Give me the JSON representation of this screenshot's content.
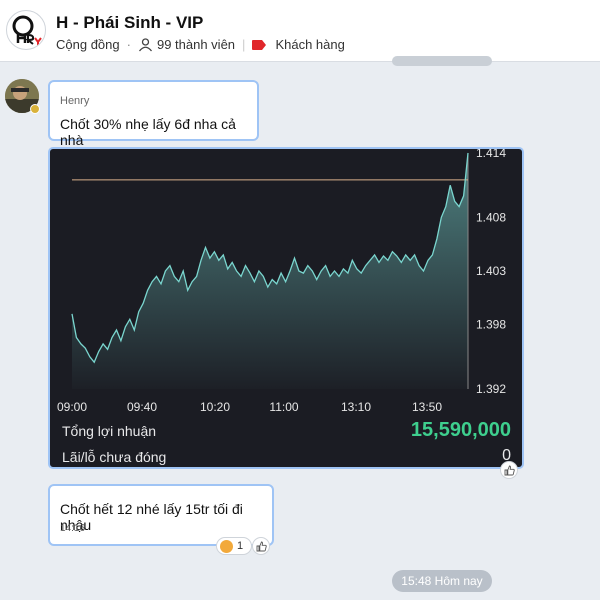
{
  "group": {
    "title": "H - Phái Sinh - VIP",
    "type_label": "Cộng đồng",
    "members_label": "99 thành viên",
    "tag_label": "Khách hàng",
    "tag_color": "#e0262a"
  },
  "messages": [
    {
      "sender": "Henry",
      "text": "Chốt 30% nhẹ lấy 6đ nha cả nhà"
    },
    {
      "text": "Chốt hết 12 nhé lấy 15tr tối đi nhậu",
      "time": "14:16",
      "reaction_count": "1"
    }
  ],
  "pnl": {
    "total_label": "Tổng lợi nhuận",
    "total_value": "15,590,000",
    "unrealized_label": "Lãi/lỗ chưa đóng",
    "unrealized_value": "0"
  },
  "date_divider": "15:48 Hôm nay",
  "colors": {
    "accent": "#9fc4f5",
    "profit": "#3ecf8e",
    "line": "#7ad6cf",
    "target_line": "#d9b08c"
  },
  "chart_data": {
    "type": "area",
    "x_ticks": [
      "09:00",
      "09:40",
      "10:20",
      "11:00",
      "13:10",
      "13:50"
    ],
    "y_ticks": [
      "1.414",
      "1.408",
      "1.403",
      "1.398",
      "1.392"
    ],
    "ylim": [
      1.392,
      1.414
    ],
    "reference_line": 1.4115,
    "series": [
      {
        "values": [
          1.399,
          1.3968,
          1.3962,
          1.3958,
          1.395,
          1.3945,
          1.3955,
          1.3962,
          1.3957,
          1.3968,
          1.3975,
          1.3965,
          1.3978,
          1.3985,
          1.3975,
          1.3992,
          1.4,
          1.4012,
          1.402,
          1.4025,
          1.4018,
          1.403,
          1.4035,
          1.4025,
          1.402,
          1.403,
          1.4012,
          1.402,
          1.4025,
          1.404,
          1.4052,
          1.4042,
          1.4048,
          1.404,
          1.4045,
          1.4032,
          1.4038,
          1.403,
          1.4025,
          1.4035,
          1.4028,
          1.402,
          1.403,
          1.4025,
          1.4015,
          1.4022,
          1.4018,
          1.4028,
          1.402,
          1.403,
          1.4042,
          1.403,
          1.4028,
          1.4035,
          1.403,
          1.4022,
          1.403,
          1.4035,
          1.4025,
          1.403,
          1.4025,
          1.4032,
          1.4028,
          1.404,
          1.4032,
          1.4028,
          1.4035,
          1.404,
          1.4045,
          1.4038,
          1.4044,
          1.404,
          1.4048,
          1.4044,
          1.4038,
          1.4045,
          1.404,
          1.4045,
          1.4035,
          1.403,
          1.404,
          1.4045,
          1.406,
          1.408,
          1.409,
          1.411,
          1.4095,
          1.409,
          1.41,
          1.414
        ]
      }
    ]
  }
}
